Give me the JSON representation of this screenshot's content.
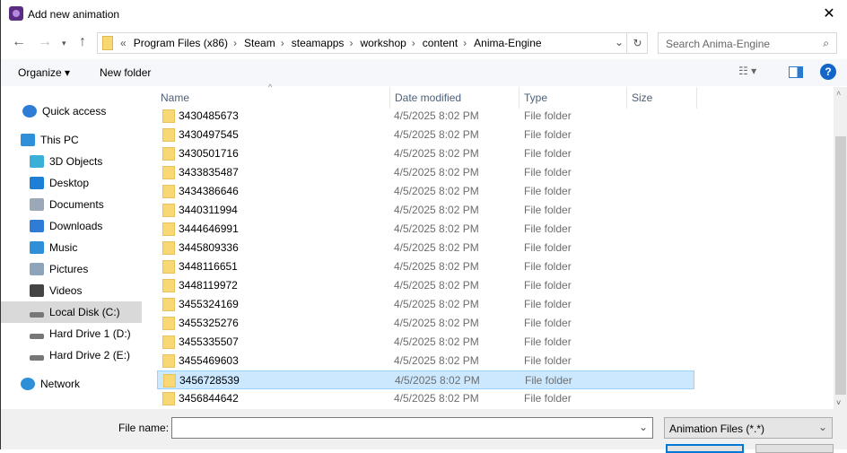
{
  "title": "Add new animation",
  "address": {
    "crumbs": [
      "Program Files (x86)",
      "Steam",
      "steamapps",
      "workshop",
      "content",
      "Anima-Engine"
    ],
    "overflow": "«"
  },
  "search": {
    "placeholder": "Search Anima-Engine"
  },
  "toolbar": {
    "organize": "Organize ▾",
    "new_folder": "New folder"
  },
  "sidebar": [
    {
      "label": "Quick access",
      "icon": "star-icon",
      "color": "#2f7cd6"
    },
    {
      "label": "This PC",
      "icon": "computer-icon",
      "color": "#2f8fd8"
    },
    {
      "label": "3D Objects",
      "icon": "cube-icon",
      "color": "#3ab0d8"
    },
    {
      "label": "Desktop",
      "icon": "desktop-icon",
      "color": "#1e7fd6"
    },
    {
      "label": "Documents",
      "icon": "document-icon",
      "color": "#9aa8b8"
    },
    {
      "label": "Downloads",
      "icon": "download-icon",
      "color": "#2f7cd6"
    },
    {
      "label": "Music",
      "icon": "music-icon",
      "color": "#2f8fd8"
    },
    {
      "label": "Pictures",
      "icon": "picture-icon",
      "color": "#8ea4b8"
    },
    {
      "label": "Videos",
      "icon": "video-icon",
      "color": "#444"
    },
    {
      "label": "Local Disk (C:)",
      "icon": "drive-icon",
      "color": "#777"
    },
    {
      "label": "Hard Drive 1 (D:)",
      "icon": "drive-icon",
      "color": "#777"
    },
    {
      "label": "Hard Drive 2 (E:)",
      "icon": "drive-icon",
      "color": "#777"
    },
    {
      "label": "Network",
      "icon": "network-icon",
      "color": "#2f8fd8"
    }
  ],
  "columns": {
    "name": "Name",
    "date": "Date modified",
    "type": "Type",
    "size": "Size"
  },
  "files": [
    {
      "name": "3430485673",
      "date": "4/5/2025 8:02 PM",
      "type": "File folder"
    },
    {
      "name": "3430497545",
      "date": "4/5/2025 8:02 PM",
      "type": "File folder"
    },
    {
      "name": "3430501716",
      "date": "4/5/2025 8:02 PM",
      "type": "File folder"
    },
    {
      "name": "3433835487",
      "date": "4/5/2025 8:02 PM",
      "type": "File folder"
    },
    {
      "name": "3434386646",
      "date": "4/5/2025 8:02 PM",
      "type": "File folder"
    },
    {
      "name": "3440311994",
      "date": "4/5/2025 8:02 PM",
      "type": "File folder"
    },
    {
      "name": "3444646991",
      "date": "4/5/2025 8:02 PM",
      "type": "File folder"
    },
    {
      "name": "3445809336",
      "date": "4/5/2025 8:02 PM",
      "type": "File folder"
    },
    {
      "name": "3448116651",
      "date": "4/5/2025 8:02 PM",
      "type": "File folder"
    },
    {
      "name": "3448119972",
      "date": "4/5/2025 8:02 PM",
      "type": "File folder"
    },
    {
      "name": "3455324169",
      "date": "4/5/2025 8:02 PM",
      "type": "File folder"
    },
    {
      "name": "3455325276",
      "date": "4/5/2025 8:02 PM",
      "type": "File folder"
    },
    {
      "name": "3455335507",
      "date": "4/5/2025 8:02 PM",
      "type": "File folder"
    },
    {
      "name": "3455469603",
      "date": "4/5/2025 8:02 PM",
      "type": "File folder"
    },
    {
      "name": "3456728539",
      "date": "4/5/2025 8:02 PM",
      "type": "File folder",
      "selected": true
    },
    {
      "name": "3456844642",
      "date": "4/5/2025 8:02 PM",
      "type": "File folder"
    }
  ],
  "bottom": {
    "file_name_label": "File name:",
    "file_name_value": "",
    "filter": "Animation Files (*.*)"
  }
}
